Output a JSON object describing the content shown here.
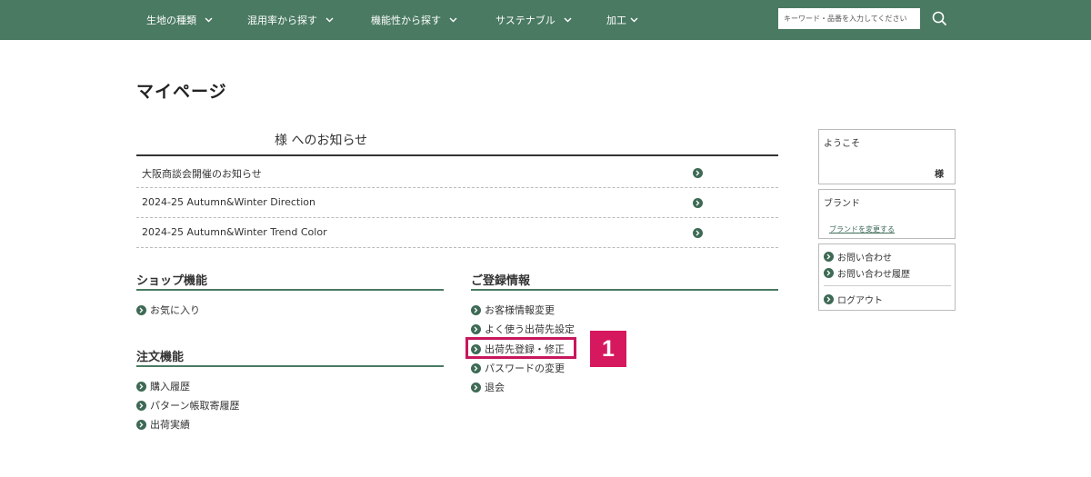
{
  "header": {
    "nav": [
      {
        "label": "生地の種類"
      },
      {
        "label": "混用率から探す"
      },
      {
        "label": "機能性から探す"
      },
      {
        "label": "サステナブル"
      },
      {
        "label": "加工"
      }
    ],
    "search_placeholder": "キーワード・品番を入力してください",
    "search_icon": "search-icon",
    "chevron_icon": "chevron-down-icon"
  },
  "page_title": "マイページ",
  "notice": {
    "title": "様 へのお知らせ",
    "items": [
      "大阪商談会開催のお知らせ",
      "2024-25 Autumn&Winter Direction",
      "2024-25 Autumn&Winter Trend Color"
    ]
  },
  "shop": {
    "title": "ショップ機能",
    "items": [
      "お気に入り"
    ]
  },
  "order": {
    "title": "注文機能",
    "items": [
      "購入履歴",
      "パターン帳取寄履歴",
      "出荷実績"
    ]
  },
  "registration": {
    "title": "ご登録情報",
    "items": [
      "お客様情報変更",
      "よく使う出荷先設定",
      "出荷先登録・修正",
      "パスワードの変更",
      "退会"
    ]
  },
  "annotation": {
    "number": "1",
    "color": "#d6185e"
  },
  "sidebar": {
    "welcome_label": "ようこそ",
    "welcome_suffix": "様",
    "brand_label": "ブランド",
    "brand_change": "ブランドを変更する",
    "links": [
      "お問い合わせ",
      "お問い合わせ履歴",
      "ログアウト"
    ]
  },
  "colors": {
    "header_bg": "#4a7a62",
    "accent": "#3e6a55",
    "highlight": "#c8175d"
  }
}
